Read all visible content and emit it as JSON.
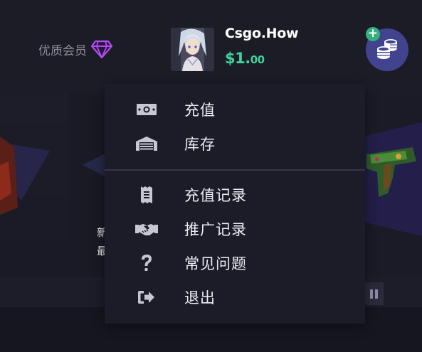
{
  "header": {
    "vip_label": "优质会员",
    "username": "Csgo.How",
    "balance_main": "$1.",
    "balance_cents": "00",
    "coin_plus": "+"
  },
  "background": {
    "text_line1": "新",
    "text_line2": "最"
  },
  "menu": {
    "items": [
      {
        "label": "充值",
        "icon": "money-bill-icon"
      },
      {
        "label": "库存",
        "icon": "warehouse-icon"
      },
      {
        "label": "充值记录",
        "icon": "receipt-icon"
      },
      {
        "label": "推广记录",
        "icon": "handshake-icon"
      },
      {
        "label": "常见问题",
        "icon": "question-icon"
      },
      {
        "label": "退出",
        "icon": "sign-out-icon"
      }
    ]
  },
  "colors": {
    "background": "#161620",
    "menu_bg": "#1c1c28",
    "balance_green": "#3ed39a",
    "coin_button": "#41438f",
    "gem_purple": "#a43ee0"
  }
}
